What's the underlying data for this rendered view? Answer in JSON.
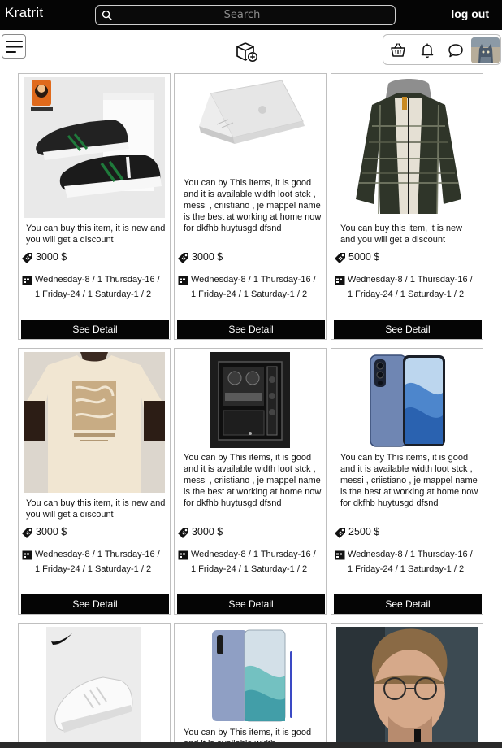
{
  "header": {
    "brand": "Kratrit",
    "search_placeholder": "Search",
    "logout_label": "log out"
  },
  "toolbar": {
    "menu_icon": "hamburger-icon",
    "center_icon": "box-add-icon",
    "actions": [
      "basket-icon",
      "bell-icon",
      "chat-icon",
      "avatar"
    ]
  },
  "colors": {
    "topbar": "#050505",
    "button": "#050505",
    "card_border": "#bfbfbf"
  },
  "cards": [
    {
      "image": "black-white-sneakers",
      "description": "You can buy this item, it is new and you will get a discount",
      "price": "3000 $",
      "date": "Wednesday-8 / 1 Thursday-16 / 1 Friday-24 / 1 Saturday-1 / 2",
      "button": "See Detail"
    },
    {
      "image": "silver-laptop",
      "description": "You can by This items, it is good and it is available width loot stck , messi , criistiano , je mappel name is the best at working at home now for dkfhb huytusgd dfsnd",
      "price": "3000 $",
      "date": "Wednesday-8 / 1 Thursday-16 / 1 Friday-24 / 1 Saturday-1 / 2",
      "button": "See Detail"
    },
    {
      "image": "plaid-hooded-jacket",
      "description": "You can buy this item, it is new and you will get a discount",
      "price": "5000 $",
      "date": "Wednesday-8 / 1 Thursday-16 / 1 Friday-24 / 1 Saturday-1 / 2",
      "button": "See Detail"
    },
    {
      "image": "peace-tshirt",
      "description": "You can buy this item, it is new and you will get a discount",
      "price": "3000 $",
      "date": "Wednesday-8 / 1 Thursday-16 / 1 Friday-24 / 1 Saturday-1 / 2",
      "button": "See Detail"
    },
    {
      "image": "pc-case",
      "description": "You can by This items, it is good and it is available width loot stck , messi , criistiano , je mappel name is the best at working at home now for dkfhb huytusgd dfsnd",
      "price": "3000 $",
      "date": "Wednesday-8 / 1 Thursday-16 / 1 Friday-24 / 1 Saturday-1 / 2",
      "button": "See Detail"
    },
    {
      "image": "blue-smartphone",
      "description": "You can by This items, it is good and it is available width loot stck , messi , criistiano , je mappel name is the best at working at home now for dkfhb huytusgd dfsnd",
      "price": "2500 $",
      "date": "Wednesday-8 / 1 Thursday-16 / 1 Friday-24 / 1 Saturday-1 / 2",
      "button": "See Detail"
    },
    {
      "image": "white-sneaker",
      "description": "",
      "price": "",
      "date": "",
      "button": ""
    },
    {
      "image": "aura-smartphone",
      "description": "You can by This items, it is good and it is available width",
      "price": "",
      "date": "",
      "button": ""
    },
    {
      "image": "man-with-glasses",
      "description": "",
      "price": "",
      "date": "",
      "button": ""
    }
  ]
}
